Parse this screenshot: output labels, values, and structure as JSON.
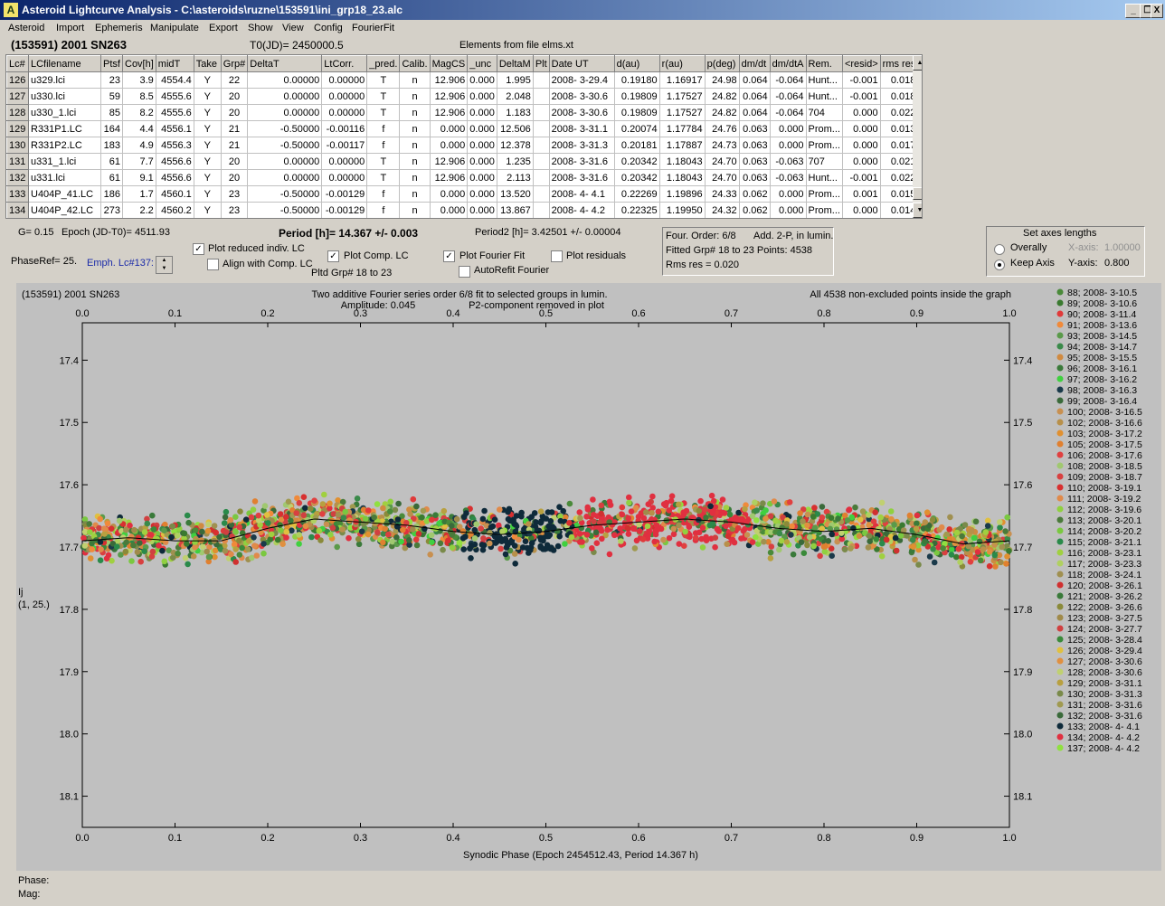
{
  "window": {
    "title": "Asteroid Lightcurve Analysis - C:\\asteroids\\ruzne\\153591\\ini_grp18_23.alc",
    "icon": "asteroid-app-icon",
    "min": "_",
    "max": "❐",
    "close": "X"
  },
  "menu": [
    "Asteroid",
    "Import",
    "Ephemeris",
    "Manipulate",
    "Export",
    "Show",
    "View",
    "Config",
    "FourierFit"
  ],
  "header": {
    "asteroid": "(153591) 2001 SN263",
    "t0": "T0(JD)= 2450000.5",
    "elements": "Elements from file elms.xt"
  },
  "table": {
    "columns": [
      "Lc#",
      "LCfilename",
      "Ptsf",
      "Cov[h]",
      "midT",
      "Take",
      "Grp#",
      "DeltaT",
      "LtCorr.",
      "_pred.",
      "Calib.",
      "MagCS",
      "_unc",
      "DeltaM",
      "Plt",
      "Date UT",
      "d(au)",
      "r(au)",
      "p(deg)",
      "dm/dt",
      "dm/dtA",
      "Rem.",
      "<resid>",
      "rms res"
    ],
    "rows": [
      [
        "126",
        "u329.lci",
        "23",
        "3.9",
        "4554.4",
        "Y",
        "22",
        "0.00000",
        "0.00000",
        "T",
        "n",
        "12.906",
        "0.000",
        "1.995",
        "",
        "2008- 3-29.4",
        "0.19180",
        "1.16917",
        "24.98",
        "0.064",
        "-0.064",
        "Hunt...",
        "-0.001",
        "0.018"
      ],
      [
        "127",
        "u330.lci",
        "59",
        "8.5",
        "4555.6",
        "Y",
        "20",
        "0.00000",
        "0.00000",
        "T",
        "n",
        "12.906",
        "0.000",
        "2.048",
        "",
        "2008- 3-30.6",
        "0.19809",
        "1.17527",
        "24.82",
        "0.064",
        "-0.064",
        "Hunt...",
        "-0.001",
        "0.018"
      ],
      [
        "128",
        "u330_1.lci",
        "85",
        "8.2",
        "4555.6",
        "Y",
        "20",
        "0.00000",
        "0.00000",
        "T",
        "n",
        "12.906",
        "0.000",
        "1.183",
        "",
        "2008- 3-30.6",
        "0.19809",
        "1.17527",
        "24.82",
        "0.064",
        "-0.064",
        "704",
        "0.000",
        "0.022"
      ],
      [
        "129",
        "R331P1.LC",
        "164",
        "4.4",
        "4556.1",
        "Y",
        "21",
        "-0.50000",
        "-0.00116",
        "f",
        "n",
        "0.000",
        "0.000",
        "12.506",
        "",
        "2008- 3-31.1",
        "0.20074",
        "1.17784",
        "24.76",
        "0.063",
        "0.000",
        "Prom...",
        "0.000",
        "0.013"
      ],
      [
        "130",
        "R331P2.LC",
        "183",
        "4.9",
        "4556.3",
        "Y",
        "21",
        "-0.50000",
        "-0.00117",
        "f",
        "n",
        "0.000",
        "0.000",
        "12.378",
        "",
        "2008- 3-31.3",
        "0.20181",
        "1.17887",
        "24.73",
        "0.063",
        "0.000",
        "Prom...",
        "0.000",
        "0.017"
      ],
      [
        "131",
        "u331_1.lci",
        "61",
        "7.7",
        "4556.6",
        "Y",
        "20",
        "0.00000",
        "0.00000",
        "T",
        "n",
        "12.906",
        "0.000",
        "1.235",
        "",
        "2008- 3-31.6",
        "0.20342",
        "1.18043",
        "24.70",
        "0.063",
        "-0.063",
        "707",
        "0.000",
        "0.021"
      ],
      [
        "132",
        "u331.lci",
        "61",
        "9.1",
        "4556.6",
        "Y",
        "20",
        "0.00000",
        "0.00000",
        "T",
        "n",
        "12.906",
        "0.000",
        "2.113",
        "",
        "2008- 3-31.6",
        "0.20342",
        "1.18043",
        "24.70",
        "0.063",
        "-0.063",
        "Hunt...",
        "-0.001",
        "0.022"
      ],
      [
        "133",
        "U404P_41.LC",
        "186",
        "1.7",
        "4560.1",
        "Y",
        "23",
        "-0.50000",
        "-0.00129",
        "f",
        "n",
        "0.000",
        "0.000",
        "13.520",
        "",
        "2008- 4- 4.1",
        "0.22269",
        "1.19896",
        "24.33",
        "0.062",
        "0.000",
        "Prom...",
        "0.001",
        "0.015"
      ],
      [
        "134",
        "U404P_42.LC",
        "273",
        "2.2",
        "4560.2",
        "Y",
        "23",
        "-0.50000",
        "-0.00129",
        "f",
        "n",
        "0.000",
        "0.000",
        "13.867",
        "",
        "2008- 4- 4.2",
        "0.22325",
        "1.19950",
        "24.32",
        "0.062",
        "0.000",
        "Prom...",
        "0.000",
        "0.014"
      ]
    ]
  },
  "controls": {
    "g": "G= 0.15",
    "epoch": "Epoch (JD-T0)= 4511.93",
    "period": "Period [h]= 14.367 +/- 0.003",
    "period2": "Period2 [h]= 3.42501 +/- 0.00004",
    "phaseref": "PhaseRef= 25.",
    "emph": "Emph. Lc#137:",
    "plot_reduced": "Plot reduced indiv. LC",
    "align": "Align with Comp. LC",
    "plot_comp": "Plot Comp. LC",
    "plot_fourier": "Plot Fourier Fit",
    "autorefit": "AutoRefit Fourier",
    "plot_residuals": "Plot residuals",
    "pltd_grp": "Pltd Grp#  18 to   23",
    "four_order": "Four. Order:  6/8",
    "add2p": "Add. 2-P, in lumin.",
    "fitted": "Fitted Grp# 18 to 23 Points: 4538",
    "rms": "Rms res     = 0.020",
    "axes_title": "Set axes lengths",
    "overally": "Overally",
    "keep_axis": "Keep Axis",
    "xaxis": "X-axis:",
    "xaxis_val": "1.00000",
    "yaxis": "Y-axis:",
    "yaxis_val": "0.800"
  },
  "graph_text": {
    "tl": "(153591) 2001 SN263",
    "center1": "Two additive Fourier series order 6/8 fit to selected groups in lumin.",
    "amp": "Amplitude: 0.045",
    "p2": "P2-component removed in plot",
    "tr": "All 4538 non-excluded points inside the graph",
    "ylabel1": "Ij",
    "ylabel2": "(1, 25.)"
  },
  "chart_data": {
    "type": "scatter",
    "xlabel": "Synodic Phase (Epoch 2454512.43, Period 14.367 h)",
    "ylabel": "Ij (1, 25.)",
    "xlim": [
      0,
      1
    ],
    "ylim": [
      18.2,
      17.4
    ],
    "xticks": [
      "0.0",
      "0.1",
      "0.2",
      "0.3",
      "0.4",
      "0.5",
      "0.6",
      "0.7",
      "0.8",
      "0.9",
      "1.0"
    ],
    "yticks": [
      "17.4",
      "17.5",
      "17.6",
      "17.7",
      "17.8",
      "17.9",
      "18.0",
      "18.1"
    ],
    "y_inverted": true,
    "fourier_fit": [
      [
        0,
        17.69
      ],
      [
        0.05,
        17.685
      ],
      [
        0.1,
        17.69
      ],
      [
        0.15,
        17.69
      ],
      [
        0.2,
        17.67
      ],
      [
        0.25,
        17.655
      ],
      [
        0.3,
        17.66
      ],
      [
        0.35,
        17.665
      ],
      [
        0.4,
        17.675
      ],
      [
        0.45,
        17.68
      ],
      [
        0.5,
        17.675
      ],
      [
        0.55,
        17.665
      ],
      [
        0.6,
        17.66
      ],
      [
        0.65,
        17.655
      ],
      [
        0.7,
        17.66
      ],
      [
        0.75,
        17.67
      ],
      [
        0.8,
        17.675
      ],
      [
        0.85,
        17.67
      ],
      [
        0.9,
        17.68
      ],
      [
        0.95,
        17.695
      ],
      [
        1.0,
        17.69
      ]
    ],
    "series": [
      {
        "name": "88; 2008- 3-10.5",
        "color": "#4a8a3a"
      },
      {
        "name": "89; 2008- 3-10.6",
        "color": "#3a7a30"
      },
      {
        "name": "90; 2008- 3-11.4",
        "color": "#e03a3a"
      },
      {
        "name": "91; 2008- 3-13.6",
        "color": "#f08a3a"
      },
      {
        "name": "93; 2008- 3-14.5",
        "color": "#5a9a4a"
      },
      {
        "name": "94; 2008- 3-14.7",
        "color": "#3a8a4a"
      },
      {
        "name": "95; 2008- 3-15.5",
        "color": "#d08a40"
      },
      {
        "name": "96; 2008- 3-16.1",
        "color": "#3a7a3a"
      },
      {
        "name": "97; 2008- 3-16.2",
        "color": "#40d040"
      },
      {
        "name": "98; 2008- 3-16.3",
        "color": "#1a3a4a"
      },
      {
        "name": "99; 2008- 3-16.4",
        "color": "#3a6a3a"
      },
      {
        "name": "100; 2008- 3-16.5",
        "color": "#c89050"
      },
      {
        "name": "102; 2008- 3-16.6",
        "color": "#b8904a"
      },
      {
        "name": "103; 2008- 3-17.2",
        "color": "#e09030"
      },
      {
        "name": "105; 2008- 3-17.5",
        "color": "#e08030"
      },
      {
        "name": "106; 2008- 3-17.6",
        "color": "#e04040"
      },
      {
        "name": "108; 2008- 3-18.5",
        "color": "#a0c870"
      },
      {
        "name": "109; 2008- 3-18.7",
        "color": "#d84040"
      },
      {
        "name": "110; 2008- 3-19.1",
        "color": "#d83030"
      },
      {
        "name": "111; 2008- 3-19.2",
        "color": "#e08a4a"
      },
      {
        "name": "112; 2008- 3-19.6",
        "color": "#90d040"
      },
      {
        "name": "113; 2008- 3-20.1",
        "color": "#4a7a3a"
      },
      {
        "name": "114; 2008- 3-20.2",
        "color": "#7ac840"
      },
      {
        "name": "115; 2008- 3-21.1",
        "color": "#2a8a4a"
      },
      {
        "name": "116; 2008- 3-23.1",
        "color": "#a0d040"
      },
      {
        "name": "117; 2008- 3-23.3",
        "color": "#b0d060"
      },
      {
        "name": "118; 2008- 3-24.1",
        "color": "#a09050"
      },
      {
        "name": "120; 2008- 3-26.1",
        "color": "#d03030"
      },
      {
        "name": "121; 2008- 3-26.2",
        "color": "#3a7a3a"
      },
      {
        "name": "122; 2008- 3-26.6",
        "color": "#8a8a3a"
      },
      {
        "name": "123; 2008- 3-27.5",
        "color": "#a08a4a"
      },
      {
        "name": "124; 2008- 3-27.7",
        "color": "#d04040"
      },
      {
        "name": "125; 2008- 3-28.4",
        "color": "#3a8a3a"
      },
      {
        "name": "126; 2008- 3-29.4",
        "color": "#e0c040"
      },
      {
        "name": "127; 2008- 3-30.6",
        "color": "#e09040"
      },
      {
        "name": "128; 2008- 3-30.6",
        "color": "#c0d070"
      },
      {
        "name": "129; 2008- 3-31.1",
        "color": "#b8a040"
      },
      {
        "name": "130; 2008- 3-31.3",
        "color": "#7a8a4a"
      },
      {
        "name": "131; 2008- 3-31.6",
        "color": "#a09a50"
      },
      {
        "name": "132; 2008- 3-31.6",
        "color": "#3a6a3a"
      },
      {
        "name": "133; 2008- 4- 4.1",
        "color": "#0e2a3a"
      },
      {
        "name": "134; 2008- 4- 4.2",
        "color": "#e03040"
      },
      {
        "name": "137; 2008- 4- 4.2",
        "color": "#90e040"
      }
    ]
  }
}
